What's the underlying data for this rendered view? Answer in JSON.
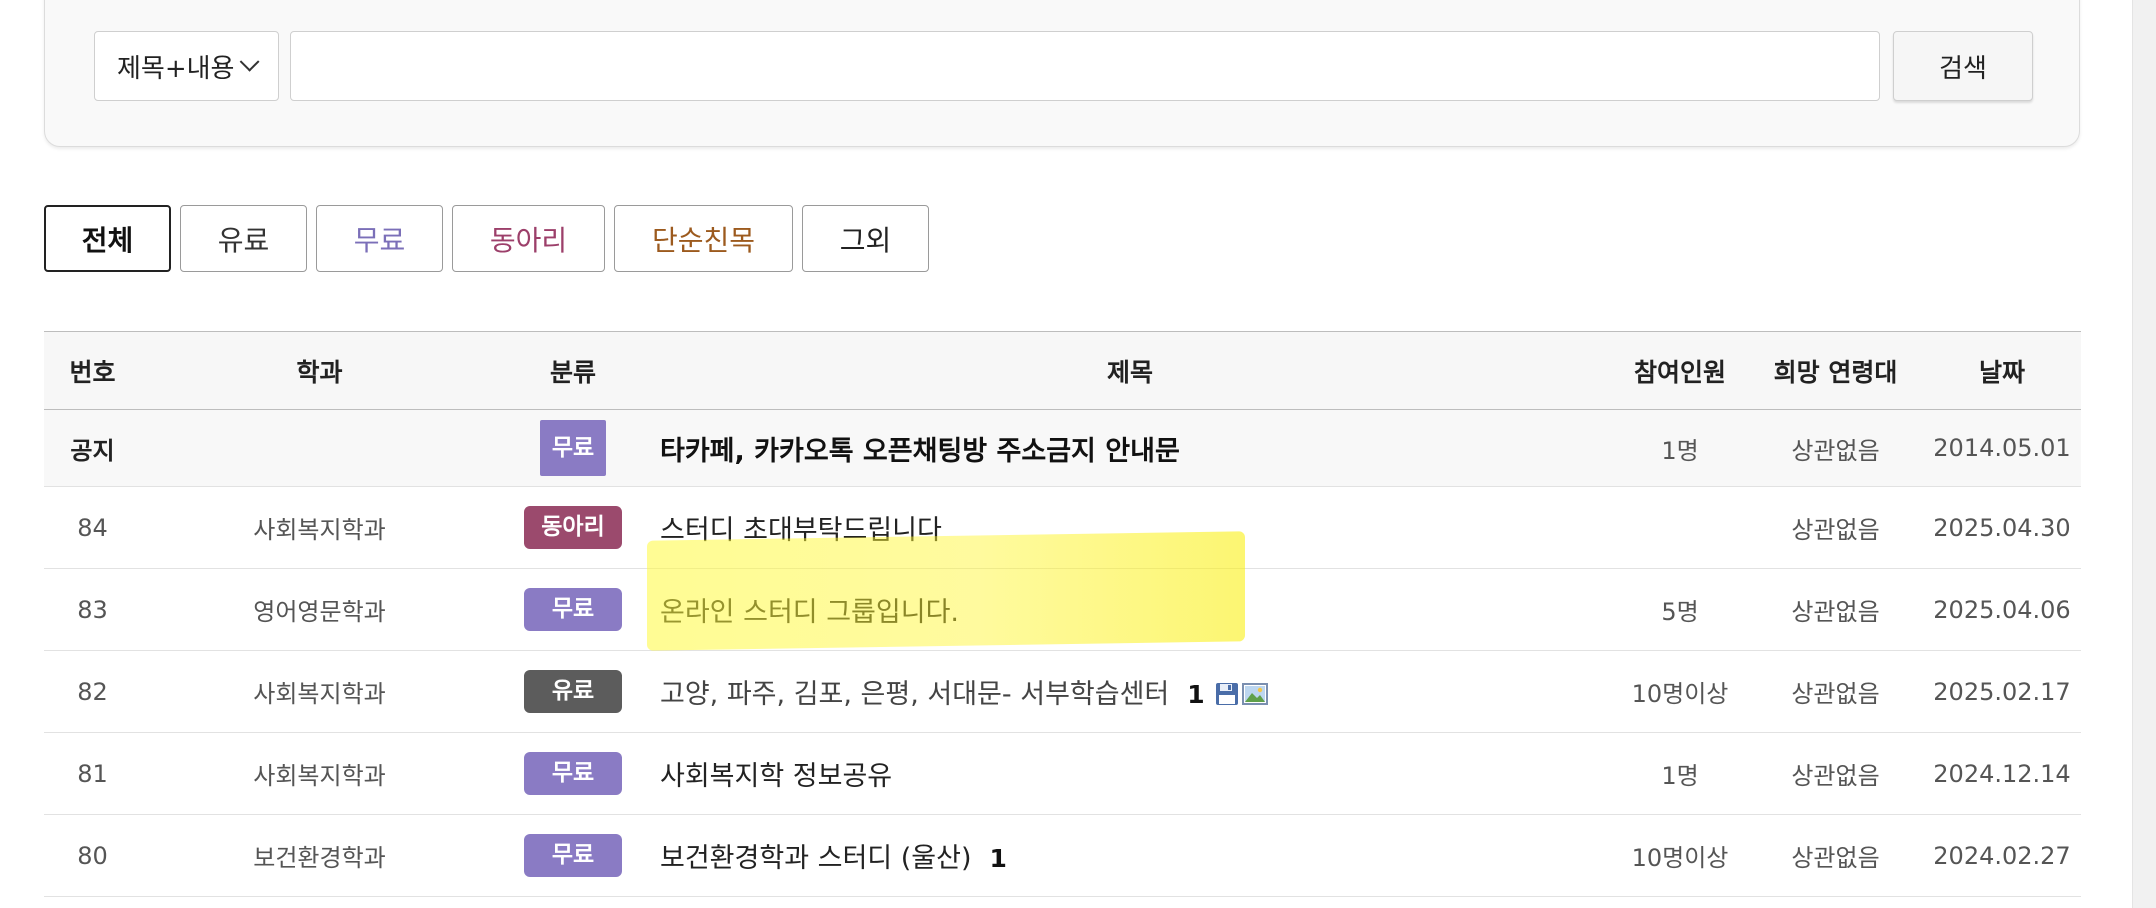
{
  "search": {
    "field_label": "제목+내용",
    "button_label": "검색",
    "query": ""
  },
  "tabs": [
    {
      "label": "전체",
      "color": "#111111",
      "active": true
    },
    {
      "label": "유료",
      "color": "#333333"
    },
    {
      "label": "무료",
      "color": "#7b6fb8"
    },
    {
      "label": "동아리",
      "color": "#9c3f6a"
    },
    {
      "label": "단순친목",
      "color": "#9c5a1e"
    },
    {
      "label": "그외",
      "color": "#222222"
    }
  ],
  "table": {
    "headers": [
      "번호",
      "학과",
      "분류",
      "제목",
      "참여인원",
      "희망 연령대",
      "날짜"
    ],
    "rows": [
      {
        "num": "공지",
        "dept": "",
        "category": "무료",
        "cat_color": "#8a7bc4",
        "title": "타카페, 카카오톡 오픈채팅방 주소금지 안내문",
        "comments": "",
        "members": "1명",
        "age": "상관없음",
        "date": "2014.05.01"
      },
      {
        "num": "84",
        "dept": "사회복지학과",
        "category": "동아리",
        "cat_color": "#9b4a6d",
        "title": "스터디 초대부탁드립니다",
        "comments": "",
        "members": "",
        "age": "상관없음",
        "date": "2025.04.30"
      },
      {
        "num": "83",
        "dept": "영어영문학과",
        "category": "무료",
        "cat_color": "#8a7bc4",
        "title": "온라인 스터디 그룹입니다.",
        "comments": "",
        "members": "5명",
        "age": "상관없음",
        "date": "2025.04.06"
      },
      {
        "num": "82",
        "dept": "사회복지학과",
        "category": "유료",
        "cat_color": "#5c5c5c",
        "title": "고양, 파주, 김포, 은평, 서대문- 서부학습센터",
        "comments": "1",
        "members": "10명이상",
        "age": "상관없음",
        "date": "2025.02.17"
      },
      {
        "num": "81",
        "dept": "사회복지학과",
        "category": "무료",
        "cat_color": "#8a7bc4",
        "title": "사회복지학 정보공유",
        "comments": "",
        "members": "1명",
        "age": "상관없음",
        "date": "2024.12.14"
      },
      {
        "num": "80",
        "dept": "보건환경학과",
        "category": "무료",
        "cat_color": "#8a7bc4",
        "title": "보건환경학과 스터디 (울산)",
        "comments": "1",
        "members": "10명이상",
        "age": "상관없음",
        "date": "2024.02.27"
      }
    ]
  },
  "icons": {
    "file": "floppy-disk-icon",
    "image": "image-icon",
    "dropdown": "chevron-down-icon"
  }
}
